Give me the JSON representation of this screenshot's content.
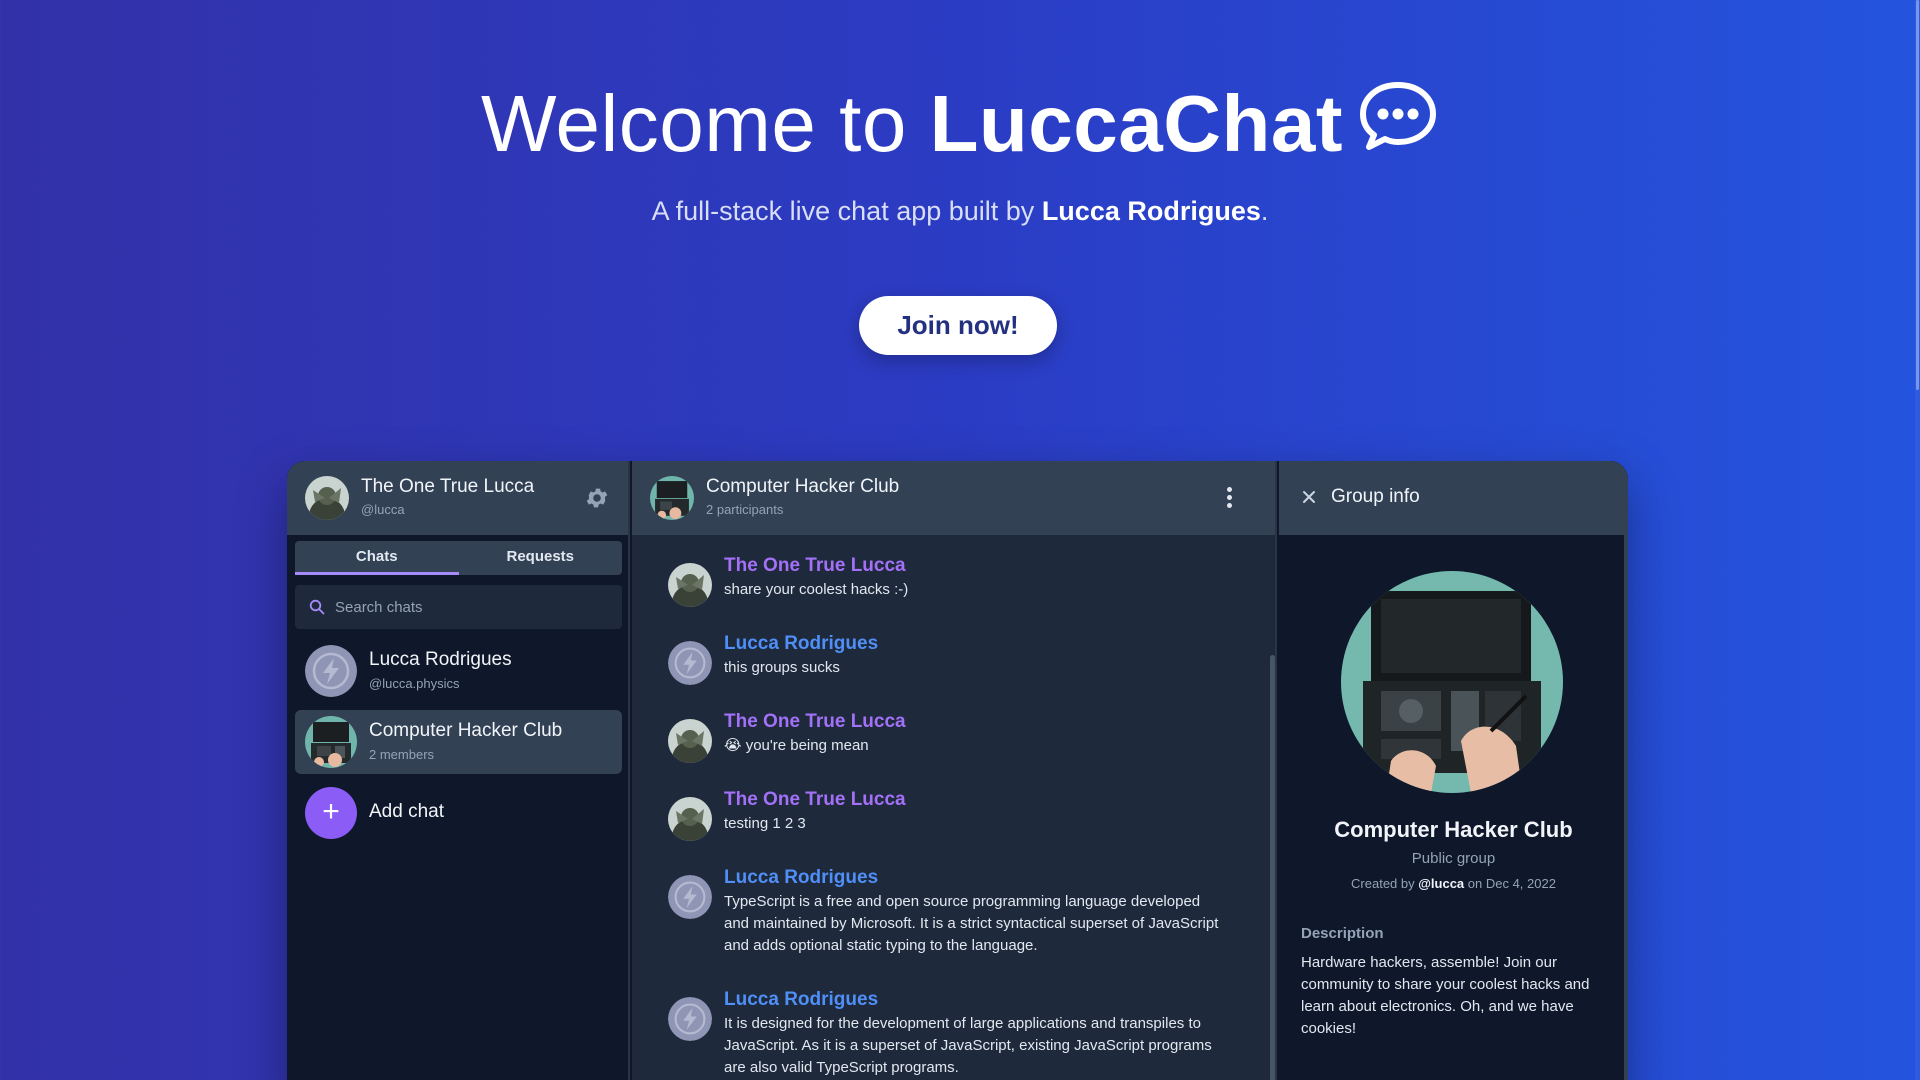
{
  "hero": {
    "title_prefix": "Welcome to ",
    "brand": "LuccaChat",
    "subtitle_prefix": "A full-stack live chat app built by ",
    "author": "Lucca Rodrigues",
    "subtitle_suffix": ".",
    "join_label": "Join now!",
    "icon": "chat-bubble-icon"
  },
  "sidebar": {
    "user": {
      "name": "The One True Lucca",
      "handle": "@lucca",
      "avatar": "avatar-lucca"
    },
    "tabs": [
      {
        "label": "Chats",
        "active": true
      },
      {
        "label": "Requests",
        "active": false
      }
    ],
    "search_placeholder": "Search chats",
    "chats": [
      {
        "name": "Lucca Rodrigues",
        "sub": "@lucca.physics",
        "avatar": "avatar-default"
      },
      {
        "name": "Computer Hacker Club",
        "sub": "2 members",
        "avatar": "avatar-group",
        "selected": true
      }
    ],
    "add_chat_label": "Add chat"
  },
  "conversation": {
    "title": "Computer Hacker Club",
    "participants": "2 participants",
    "messages": [
      {
        "author": "The One True Lucca",
        "text": "share your coolest hacks :-)",
        "color": "purple"
      },
      {
        "author": "Lucca Rodrigues",
        "text": "this groups sucks",
        "color": "blue"
      },
      {
        "author": "The One True Lucca",
        "text": "😭 you're being mean",
        "color": "purple"
      },
      {
        "author": "The One True Lucca",
        "text": "testing 1 2 3",
        "color": "purple"
      },
      {
        "author": "Lucca Rodrigues",
        "text": "TypeScript is a free and open source programming language developed and maintained by Microsoft. It is a strict syntactical superset of JavaScript and adds optional static typing to the language.",
        "color": "blue"
      },
      {
        "author": "Lucca Rodrigues",
        "text": "It is designed for the development of large applications and transpiles to JavaScript. As it is a superset of JavaScript, existing JavaScript programs are also valid TypeScript programs.",
        "color": "blue"
      }
    ]
  },
  "group_info": {
    "panel_title": "Group info",
    "name": "Computer Hacker Club",
    "type": "Public group",
    "created_prefix": "Created by ",
    "created_by": "@lucca",
    "created_suffix": " on Dec 4, 2022",
    "description_label": "Description",
    "description": "Hardware hackers, assemble! Join our community to share your coolest hacks and learn about electronics. Oh, and we have cookies!"
  },
  "colors": {
    "accent": "#8b5cf6",
    "author_purple": "#a371f7",
    "author_blue": "#4f8ff7",
    "panel_dark": "#0f172a",
    "panel_mid": "#1e293b",
    "header": "#334155"
  }
}
